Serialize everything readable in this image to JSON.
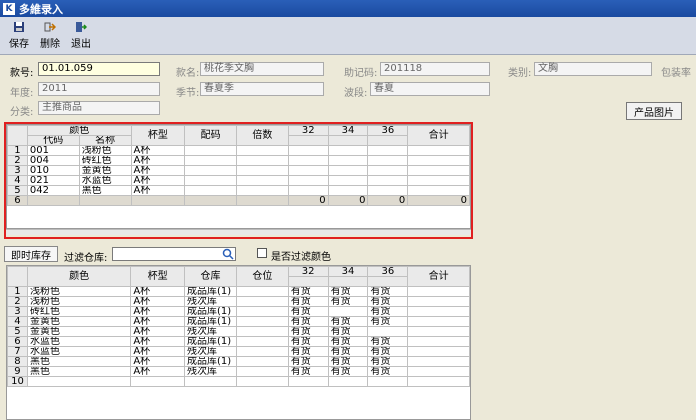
{
  "window": {
    "title": "多維录入",
    "logo": "K"
  },
  "toolbar": {
    "save": "保存",
    "delete": "删除",
    "exit": "退出"
  },
  "form": {
    "code_label": "款号:",
    "code_value": "01.01.059",
    "name_label": "款名:",
    "name_value": "桃花季文胸",
    "memo_label": "助记码:",
    "memo_value": "201118",
    "category_label": "类别:",
    "category_value": "文胸",
    "pack_label": "包装率",
    "year_label": "年度:",
    "year_value": "2011",
    "season_label": "季节:",
    "season_value": "春夏季",
    "band_label": "波段:",
    "band_value": "春夏",
    "class_label": "分类:",
    "class_value": "主推商品",
    "photo_button": "产品图片"
  },
  "entry_grid": {
    "color_header": "颜色",
    "code_header": "代码",
    "name_header": "名称",
    "cup_header": "杯型",
    "ratio_header": "配码",
    "multiple_header": "倍数",
    "sizes": [
      "32",
      "34",
      "36"
    ],
    "total_header": "合计",
    "rows": [
      {
        "n": "1",
        "code": "001",
        "name": "浅粉色",
        "cup": "A杯"
      },
      {
        "n": "2",
        "code": "004",
        "name": "砖红色",
        "cup": "A杯"
      },
      {
        "n": "3",
        "code": "010",
        "name": "金黄色",
        "cup": "A杯"
      },
      {
        "n": "4",
        "code": "021",
        "name": "水蓝色",
        "cup": "A杯"
      },
      {
        "n": "5",
        "code": "042",
        "name": "黑色",
        "cup": "A杯"
      }
    ],
    "sum_row": {
      "n": "6",
      "s32": "0",
      "s34": "0",
      "s36": "0",
      "total": "0"
    }
  },
  "stock": {
    "tab_label": "即时库存",
    "filter_label": "过滤仓库:",
    "filter_value": "",
    "filter_color_label": "是否过滤颜色",
    "color_header": "颜色",
    "cup_header": "杯型",
    "warehouse_header": "仓库",
    "location_header": "仓位",
    "sizes": [
      "32",
      "34",
      "36"
    ],
    "total_header": "合计",
    "rows": [
      {
        "n": "1",
        "color": "浅粉色",
        "cup": "A杯",
        "wh": "成品库(1)",
        "s32": "有货",
        "s34": "有货",
        "s36": "有货"
      },
      {
        "n": "2",
        "color": "浅粉色",
        "cup": "A杯",
        "wh": "残次库",
        "s32": "有货",
        "s34": "有货",
        "s36": "有货"
      },
      {
        "n": "3",
        "color": "砖红色",
        "cup": "A杯",
        "wh": "成品库(1)",
        "s32": "有货",
        "s34": "",
        "s36": "有货"
      },
      {
        "n": "4",
        "color": "金黄色",
        "cup": "A杯",
        "wh": "成品库(1)",
        "s32": "有货",
        "s34": "有货",
        "s36": "有货"
      },
      {
        "n": "5",
        "color": "金黄色",
        "cup": "A杯",
        "wh": "残次库",
        "s32": "有货",
        "s34": "有货",
        "s36": ""
      },
      {
        "n": "6",
        "color": "水蓝色",
        "cup": "A杯",
        "wh": "成品库(1)",
        "s32": "有货",
        "s34": "有货",
        "s36": "有货"
      },
      {
        "n": "7",
        "color": "水蓝色",
        "cup": "A杯",
        "wh": "残次库",
        "s32": "有货",
        "s34": "有货",
        "s36": "有货"
      },
      {
        "n": "8",
        "color": "黑色",
        "cup": "A杯",
        "wh": "成品库(1)",
        "s32": "有货",
        "s34": "有货",
        "s36": "有货"
      },
      {
        "n": "9",
        "color": "黑色",
        "cup": "A杯",
        "wh": "残次库",
        "s32": "有货",
        "s34": "有货",
        "s36": "有货"
      },
      {
        "n": "10",
        "color": "",
        "cup": "",
        "wh": "",
        "s32": "",
        "s34": "",
        "s36": ""
      }
    ]
  }
}
